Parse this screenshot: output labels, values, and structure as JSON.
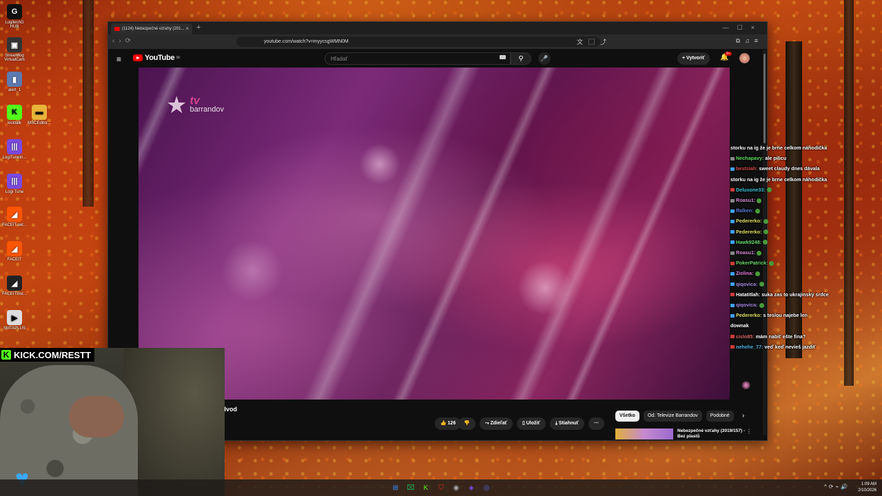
{
  "desktop": {
    "icons": [
      {
        "label": "LogitechG HUB",
        "glyph": "G",
        "color": "#111111"
      },
      {
        "label": "Streamfog VirtualCam",
        "glyph": "▣",
        "color": "#333333"
      },
      {
        "label": "alert_1",
        "glyph": "▮",
        "color": "#5b7ab0"
      },
      {
        "label": "kicktalk",
        "glyph": "K",
        "color": "#53fc18"
      },
      {
        "label": "MSCEditor...",
        "glyph": "▬",
        "color": "#e8b43a"
      },
      {
        "label": "LogiTuneIn...",
        "glyph": "|||",
        "color": "#7a4ae0"
      },
      {
        "label": "Logi Tune",
        "glyph": "|||",
        "color": "#7a4ae0"
      },
      {
        "label": "FACEIT-set...",
        "glyph": "◢",
        "color": "#ff5500"
      },
      {
        "label": "FACEIT",
        "glyph": "◢",
        "color": "#ff5500"
      },
      {
        "label": "FACEITInst...",
        "glyph": "◢",
        "color": "#222222"
      },
      {
        "label": "SMTAPLUS",
        "glyph": "▶",
        "color": "#dddddd"
      }
    ]
  },
  "browser": {
    "tab_title": "(1124) Nebezpečné vzťahy (201...",
    "tab_close": "×",
    "new_tab": "+",
    "window_controls": "—☐×",
    "nav_icons": "‹›⟳",
    "url": "youtube.com/watch?v=myycsgWMN0M",
    "bookmark_icon": "🔖",
    "toolbar_mid_icons": "文▢⤴",
    "toolbar_right_icons": "⧉♫≡"
  },
  "youtube": {
    "hamburger": "≡",
    "logo_text": "YouTube",
    "logo_region": "SK",
    "search_placeholder": "Hľadať",
    "search_icon": "⚲",
    "mic_icon": "🎤",
    "create_label": "+ Vytvoriť",
    "bell_icon": "🔔",
    "notif_badge": "9+",
    "video_channel_logo_tv": "tv",
    "video_channel_logo_brand": "barrandov",
    "video_channel_logo_star": "★",
    "title_fragment": "odvod",
    "actions": {
      "like_count": "👍 126",
      "dislike": "👎",
      "share": "⤳ Zdieľať",
      "save": "▯ Uložiť",
      "download": "⤓ Stiahnuť",
      "more": "⋯"
    },
    "chips": [
      "Všetko",
      "Od: Televize Barrandov",
      "Podobné"
    ],
    "chips_next": "›",
    "recommended": {
      "title": "Nebezpečné vzťahy (2019/157) - Bez plastů",
      "more": "⋮"
    }
  },
  "chat": {
    "messages": [
      {
        "user": "",
        "text": "storku na ig že je brne celkom náhodička",
        "color": "#ffffff",
        "badge": ""
      },
      {
        "user": "Nechapavy:",
        "text": " ale pilicu",
        "color": "#5fdc5f",
        "badge": "#888888"
      },
      {
        "user": "bestsiah:",
        "text": " sweet claudy dnes dávala",
        "color": "#d24a4a",
        "badge": "#3fa0ff"
      },
      {
        "user": "",
        "text": "storku na ig že je brne celkom náhodička",
        "color": "#ffffff",
        "badge": ""
      },
      {
        "user": "Deluxone33:",
        "text": "",
        "color": "#37c4d8",
        "badge": "#d23a3a"
      },
      {
        "user": "Roasu1:",
        "text": "",
        "color": "#d88ad8",
        "badge": "#888888"
      },
      {
        "user": "ffalken:",
        "text": "",
        "color": "#5a7ad8",
        "badge": "#3fa0ff"
      },
      {
        "user": "Pedererko:",
        "text": "",
        "color": "#e0e060",
        "badge": "#3fa0ff"
      },
      {
        "user": "Pedererko:",
        "text": "",
        "color": "#e0e060",
        "badge": "#3fa0ff"
      },
      {
        "user": "Hawk9248:",
        "text": "",
        "color": "#6ad86a",
        "badge": "#3fa0ff"
      },
      {
        "user": "Roasu1:",
        "text": "",
        "color": "#d88ad8",
        "badge": "#888888"
      },
      {
        "user": "PokerPatrick:",
        "text": "",
        "color": "#6ad86a",
        "badge": "#d23a3a"
      },
      {
        "user": "Ziolina:",
        "text": "",
        "color": "#e07ad8",
        "badge": "#3fa0ff"
      },
      {
        "user": "qiqovica:",
        "text": "",
        "color": "#a88ae0",
        "badge": "#3fa0ff"
      },
      {
        "user": "Hatatitlah:",
        "text": " suka zas to ukrajinský srdce",
        "color": "#ffffff",
        "badge": "#d23a3a"
      },
      {
        "user": "qiqovica:",
        "text": "",
        "color": "#a88ae0",
        "badge": "#3fa0ff"
      },
      {
        "user": "Pedererko:",
        "text": " s teslou najebe len",
        "color": "#e0e060",
        "badge": "#3fa0ff"
      },
      {
        "user": "",
        "text": "downak",
        "color": "#ffffff",
        "badge": ""
      },
      {
        "user": "cislo85:",
        "text": " mám nabiť ešte fina?",
        "color": "#d86a6a",
        "badge": "#d23a3a"
      },
      {
        "user": "nehehe_77:",
        "text": " veď keď nevieš jazdiť",
        "color": "#4ab4e0",
        "badge": "#d23a3a"
      }
    ],
    "kick_icon": "✺"
  },
  "stream_overlay": {
    "kick_badge": "K",
    "kick_url": "KICK.COM/RESTT",
    "heart": "♥"
  },
  "taskbar": {
    "apps": [
      "⊞",
      "⌧",
      "K",
      "⛉",
      "◉",
      "◈",
      "◎"
    ],
    "tray_icons": "^⟳⌁🔊",
    "time": "1:09 AM",
    "date": "2/10/2026"
  }
}
